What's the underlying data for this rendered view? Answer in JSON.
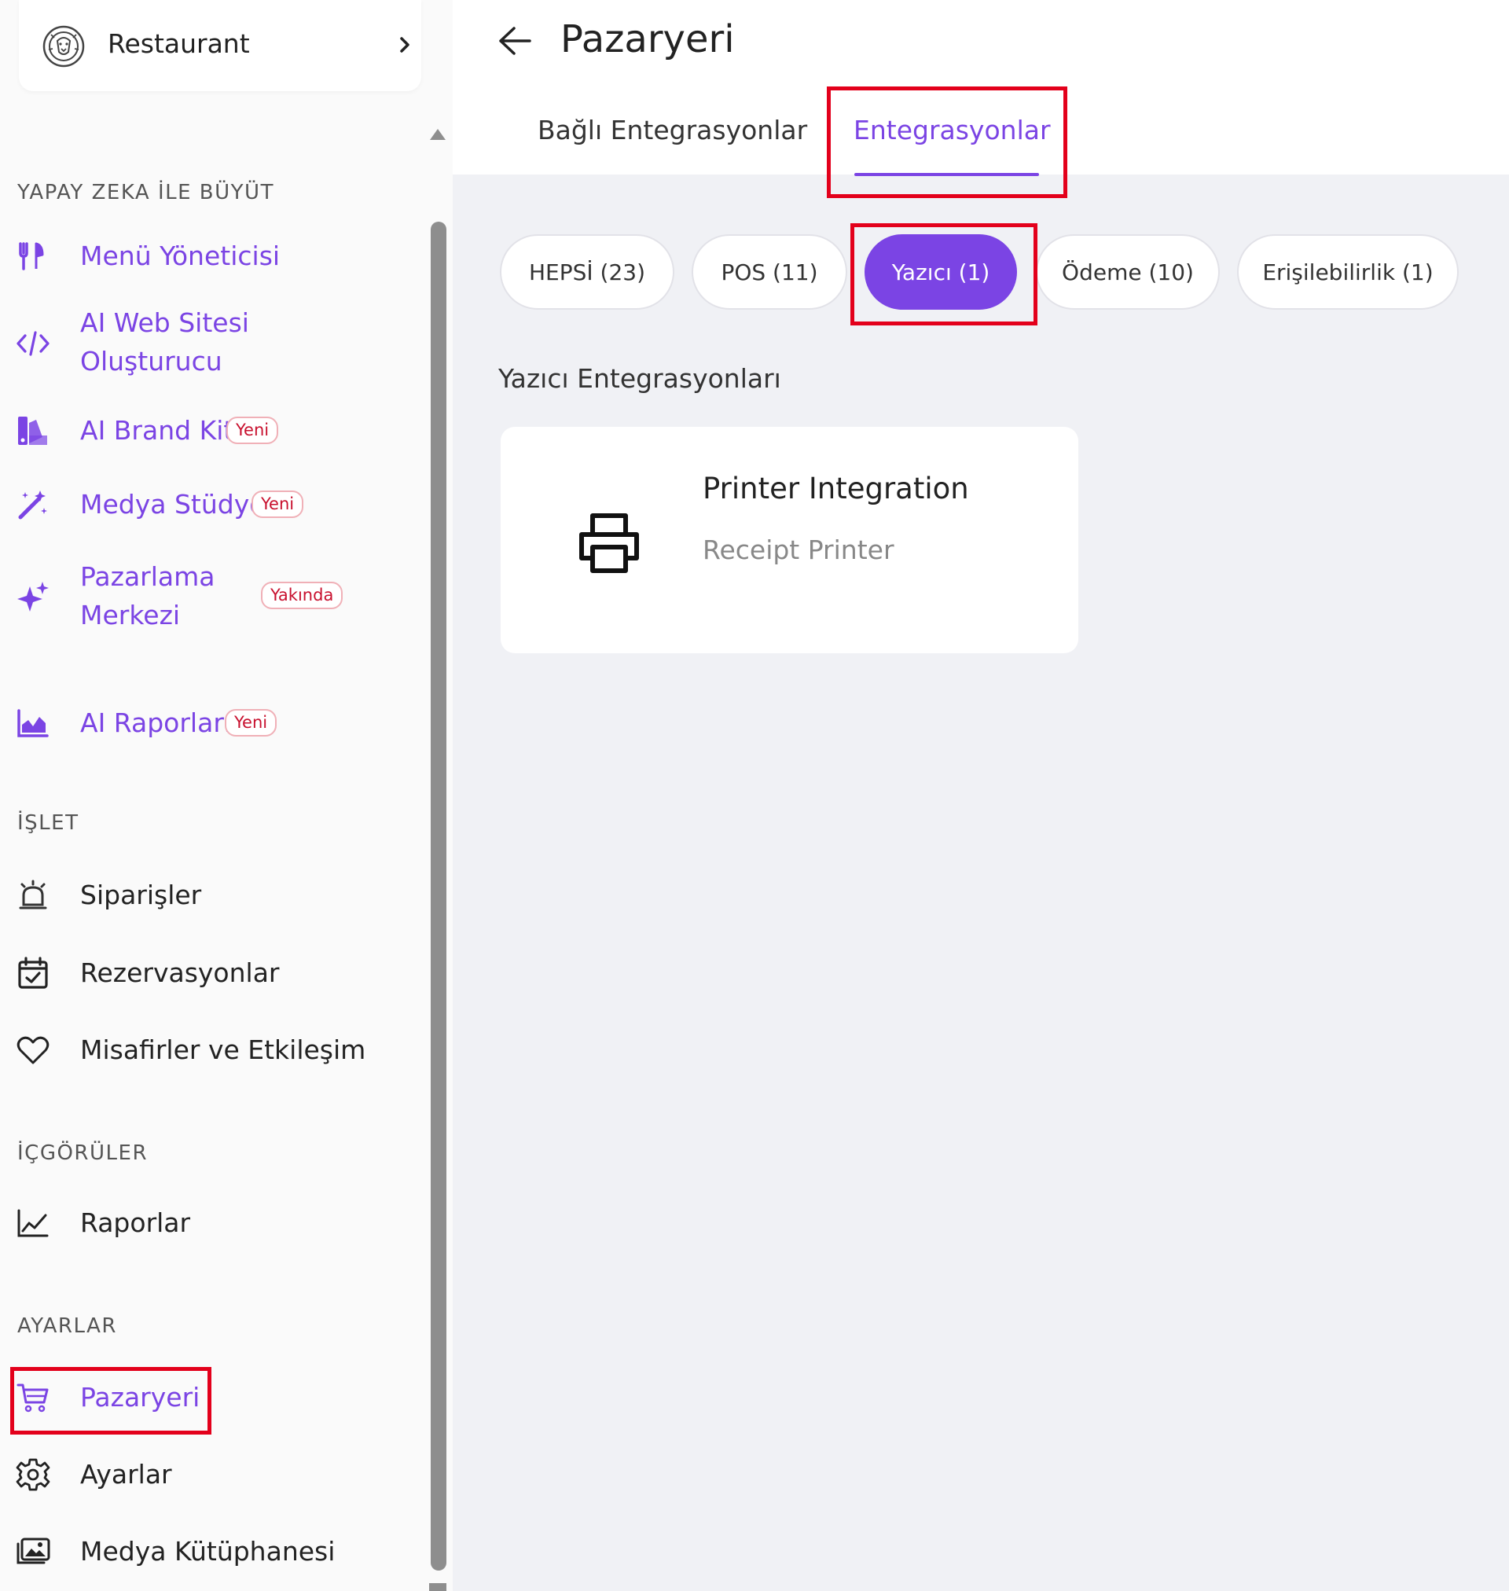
{
  "colors": {
    "accent": "#7b44e4",
    "highlight_box": "#e3001b",
    "badge_text": "#c8102e",
    "main_background": "#f0f1f5",
    "sidebar_background": "#fafafa"
  },
  "sidebar": {
    "restaurant": {
      "name": "Restaurant",
      "logo_icon": "lion-head-logo",
      "chevron_icon": "chevron-right-icon"
    },
    "sections": {
      "ai": {
        "title": "YAPAY ZEKA İLE BÜYÜT",
        "items": [
          {
            "label": "Menü Yöneticisi",
            "icon": "fork-knife-icon",
            "badge": ""
          },
          {
            "label_line1": "AI Web Sitesi",
            "label_line2": "Oluşturucu",
            "icon": "code-icon",
            "badge": ""
          },
          {
            "label": "AI Brand Kit",
            "icon": "palette-icon",
            "badge": "Yeni"
          },
          {
            "label": "Medya Stüdyo",
            "icon": "magic-wand-icon",
            "badge": "Yeni"
          },
          {
            "label_line1": "Pazarlama",
            "label_line2": "Merkezi",
            "icon": "sparkles-icon",
            "badge": "Yakında"
          },
          {
            "label": "AI Raporları",
            "icon": "area-chart-icon",
            "badge": "Yeni"
          }
        ]
      },
      "operate": {
        "title": "İŞLET",
        "items": [
          {
            "label": "Siparişler",
            "icon": "bell-icon"
          },
          {
            "label": "Rezervasyonlar",
            "icon": "calendar-check-icon"
          },
          {
            "label": "Misafirler ve Etkileşim",
            "icon": "heart-icon"
          }
        ]
      },
      "insights": {
        "title": "İÇGÖRÜLER",
        "items": [
          {
            "label": "Raporlar",
            "icon": "line-chart-icon"
          }
        ]
      },
      "settings": {
        "title": "AYARLAR",
        "items": [
          {
            "label": "Pazaryeri",
            "icon": "cart-icon",
            "active": true
          },
          {
            "label": "Ayarlar",
            "icon": "gear-icon"
          },
          {
            "label": "Medya Kütüphanesi",
            "icon": "media-library-icon"
          }
        ]
      }
    }
  },
  "main": {
    "title": "Pazaryeri",
    "back_icon": "arrow-left-icon",
    "tabs": [
      {
        "label": "Bağlı Entegrasyonlar",
        "active": false
      },
      {
        "label": "Entegrasyonlar",
        "active": true
      }
    ],
    "filters": [
      {
        "label": "HEPSİ (23)",
        "active": false
      },
      {
        "label": "POS (11)",
        "active": false
      },
      {
        "label": "Yazıcı (1)",
        "active": true
      },
      {
        "label": "Ödeme (10)",
        "active": false
      },
      {
        "label": "Erişilebilirlik (1)",
        "active": false
      }
    ],
    "section_heading": "Yazıcı Entegrasyonları",
    "cards": [
      {
        "title": "Printer Integration",
        "subtitle": "Receipt Printer",
        "icon": "printer-icon"
      }
    ]
  }
}
